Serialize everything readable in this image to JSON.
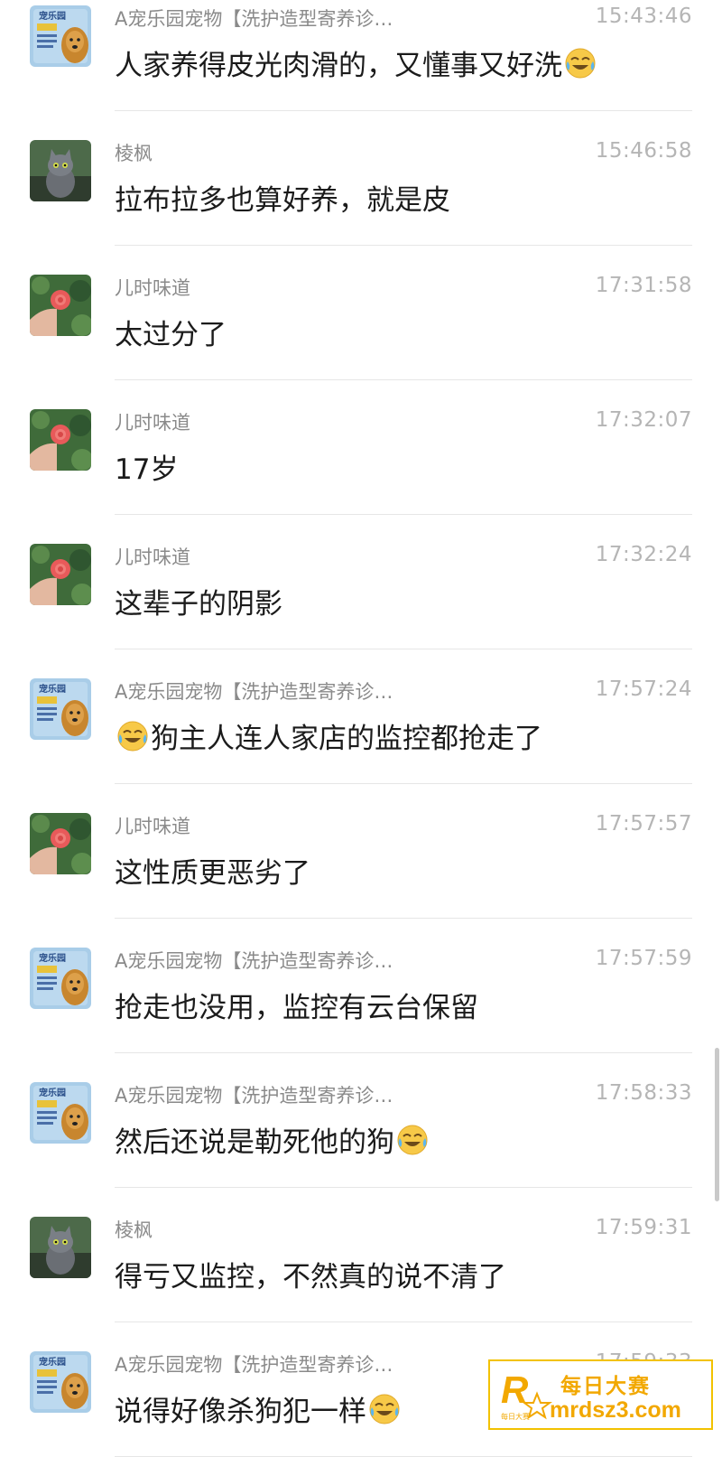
{
  "messages": [
    {
      "sender": "A宠乐园宠物【洗护造型寄养诊…",
      "time": "15:43:46",
      "text": "人家养得皮光肉滑的，又懂事又好洗",
      "emoji_after": "laughing-crying-emoji",
      "avatar": "pet-shop-avatar"
    },
    {
      "sender": "棱枫",
      "time": "15:46:58",
      "text": "拉布拉多也算好养，就是皮",
      "avatar": "cat-avatar"
    },
    {
      "sender": "儿时味道",
      "time": "17:31:58",
      "text": "太过分了",
      "avatar": "flower-avatar"
    },
    {
      "sender": "儿时味道",
      "time": "17:32:07",
      "text": "17岁",
      "avatar": "flower-avatar"
    },
    {
      "sender": "儿时味道",
      "time": "17:32:24",
      "text": "这辈子的阴影",
      "avatar": "flower-avatar"
    },
    {
      "sender": "A宠乐园宠物【洗护造型寄养诊…",
      "time": "17:57:24",
      "text": "狗主人连人家店的监控都抢走了",
      "emoji_before": "laughing-crying-emoji",
      "avatar": "pet-shop-avatar"
    },
    {
      "sender": "儿时味道",
      "time": "17:57:57",
      "text": "这性质更恶劣了",
      "avatar": "flower-avatar"
    },
    {
      "sender": "A宠乐园宠物【洗护造型寄养诊…",
      "time": "17:57:59",
      "text": "抢走也没用，监控有云台保留",
      "avatar": "pet-shop-avatar"
    },
    {
      "sender": "A宠乐园宠物【洗护造型寄养诊…",
      "time": "17:58:33",
      "text": "然后还说是勒死他的狗",
      "emoji_after": "laughing-crying-emoji",
      "avatar": "pet-shop-avatar"
    },
    {
      "sender": "棱枫",
      "time": "17:59:31",
      "text": "得亏又监控，不然真的说不清了",
      "avatar": "cat-avatar"
    },
    {
      "sender": "A宠乐园宠物【洗护造型寄养诊…",
      "time": "17:59:33",
      "text": "说得好像杀狗犯一样",
      "emoji_after": "laughing-crying-emoji",
      "avatar": "pet-shop-avatar"
    }
  ],
  "avatars": {
    "pet_shop_sign": "宠乐园"
  },
  "watermark": {
    "title": "每日大赛",
    "url": "mrdsz3.com",
    "logo_letter": "R",
    "logo_caption": "每日大赛",
    "color": "#f2a800"
  },
  "colors": {
    "sender": "#8a8a8a",
    "time": "#b5b5b5",
    "text": "#1b1b1b",
    "divider": "#e6e6e6"
  }
}
